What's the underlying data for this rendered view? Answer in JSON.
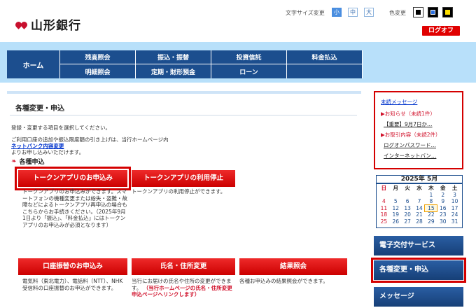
{
  "header": {
    "bank_name": "山形銀行",
    "font_size_label": "文字サイズ変更",
    "font_sizes": [
      "小",
      "中",
      "大"
    ],
    "color_label": "色変更",
    "logout_label": "ログオフ"
  },
  "nav": {
    "home": "ホーム",
    "columns": [
      [
        "残高照会",
        "明細照会"
      ],
      [
        "振込・振替",
        "定期・財形預金"
      ],
      [
        "投資信託",
        "ローン"
      ],
      [
        "料金払込",
        ""
      ]
    ]
  },
  "main": {
    "title": "各種変更・申込",
    "intro1": "登録・変更する項目を選択してください。",
    "intro2_line1": "ご利用口座の追加や振込限度額の引き上げは、当行ホームページ内",
    "intro2_link": "ネットバンク内容変更",
    "intro2_line3": "よりお申し込みいただけます。",
    "section": "各種申込",
    "buttons": [
      {
        "label": "トークンアプリのお申込み",
        "desc": "トークンアプリのお申込みができます。スマートフォンの機種変更または紛失・盗難・故障などによるトークンアプリ再申込の場合もこちらからお手続きください。（2025年9月1日より「振込」、「料金払込」にはトークンアプリのお申込みが必須となります）"
      },
      {
        "label": "トークンアプリの利用停止",
        "desc": "トークンアプリの利用停止ができます。"
      },
      {
        "label": "口座振替のお申込み",
        "desc": "電気料（東北電力）、電話料（NTT）、NHK受信料の口座振替のお申込ができます。"
      },
      {
        "label": "氏名・住所変更",
        "desc": "当行にお届けの氏名や住所の変更ができます。",
        "desc_red": "（当行ホームページの氏名・住所変更申込ページへリンクします）"
      },
      {
        "label": "結果照会",
        "desc": "各種お申込みの結果照会ができます。"
      }
    ]
  },
  "notice": {
    "title": "未読メッセージ",
    "oshirase": "▶お知らせ（未読1件）",
    "oshirase_item": "【重要】9月7日か…",
    "torihiki": "▶お取引内容（未読2件）",
    "torihiki_item1": "ログオンパスワード…",
    "torihiki_item2": "インターネットバン…"
  },
  "calendar": {
    "title": "2025年 5月",
    "weekdays": [
      "日",
      "月",
      "火",
      "水",
      "木",
      "金",
      "土"
    ],
    "days": [
      "",
      "",
      "",
      "",
      "1",
      "2",
      "3",
      "4",
      "5",
      "6",
      "7",
      "8",
      "9",
      "10",
      "11",
      "12",
      "13",
      "14",
      "15",
      "16",
      "17",
      "18",
      "19",
      "20",
      "21",
      "22",
      "23",
      "24",
      "25",
      "26",
      "27",
      "28",
      "29",
      "30",
      "31"
    ],
    "today": "15"
  },
  "side_buttons": [
    "電子交付サービス",
    "各種変更・申込",
    "メッセージ"
  ],
  "colors": {
    "navy": "#1c4e8e",
    "red": "#cc0000",
    "highlight": "#d40000",
    "sky": "#b8e0fa"
  }
}
